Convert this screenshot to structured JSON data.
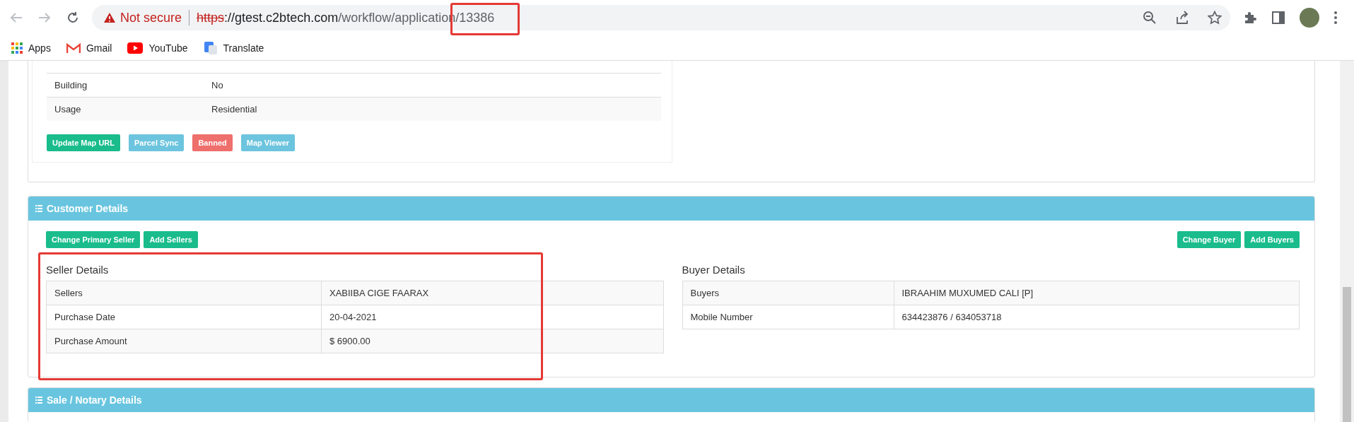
{
  "browser": {
    "security_label": "Not secure",
    "url_scheme": "https",
    "url_host": "://gtest.c2btech.com",
    "url_path": "/workflow/application/13386",
    "bookmarks": [
      {
        "label": "Apps",
        "kind": "apps"
      },
      {
        "label": "Gmail",
        "kind": "gmail"
      },
      {
        "label": "YouTube",
        "kind": "youtube"
      },
      {
        "label": "Translate",
        "kind": "translate"
      }
    ]
  },
  "parcel": {
    "rows": [
      {
        "label": "Building",
        "value": "No"
      },
      {
        "label": "Usage",
        "value": "Residential"
      }
    ],
    "buttons": [
      {
        "label": "Update Map URL",
        "kind": "success"
      },
      {
        "label": "Parcel Sync",
        "kind": "info"
      },
      {
        "label": "Banned",
        "kind": "danger"
      },
      {
        "label": "Map Viewer",
        "kind": "info"
      }
    ]
  },
  "customer_details": {
    "title": "Customer Details",
    "seller_buttons": [
      {
        "label": "Change Primary Seller",
        "kind": "success"
      },
      {
        "label": "Add Sellers",
        "kind": "success"
      }
    ],
    "buyer_buttons": [
      {
        "label": "Change Buyer",
        "kind": "success"
      },
      {
        "label": "Add Buyers",
        "kind": "success"
      }
    ],
    "seller": {
      "title": "Seller Details",
      "rows": [
        {
          "label": "Sellers",
          "value": "XABIIBA CIGE FAARAX"
        },
        {
          "label": "Purchase Date",
          "value": "20-04-2021"
        },
        {
          "label": "Purchase Amount",
          "value": "$ 6900.00"
        }
      ]
    },
    "buyer": {
      "title": "Buyer Details",
      "rows": [
        {
          "label": "Buyers",
          "value": "IBRAAHIM MUXUMED CALI [P]"
        },
        {
          "label": "Mobile Number",
          "value": "634423876 / 634053718"
        }
      ]
    }
  },
  "sale_notary": {
    "title": "Sale / Notary Details"
  }
}
